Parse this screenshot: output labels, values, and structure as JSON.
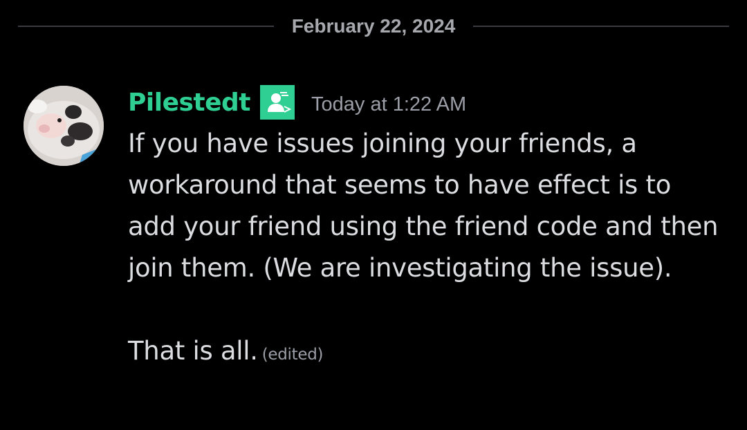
{
  "date_divider": {
    "text": "February 22, 2024"
  },
  "message": {
    "username": "Pilestedt",
    "username_color": "#2fcf94",
    "role_icon": "staff-badge-icon",
    "timestamp": "Today at 1:22 AM",
    "paragraphs": [
      "If you have issues joining your friends, a workaround that seems to have effect is to add your friend using the friend code and then join them. (We are investigating the issue).",
      "That is all."
    ],
    "edited_label": "(edited)"
  },
  "colors": {
    "background": "#000000",
    "divider_line": "#3a3c42",
    "text": "#dcdde1",
    "muted": "#9b9ea6",
    "accent": "#2fcf94"
  }
}
